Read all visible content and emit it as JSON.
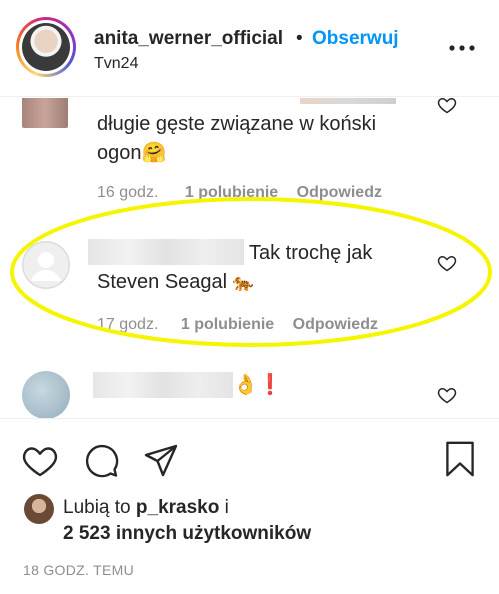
{
  "header": {
    "username": "anita_werner_official",
    "separator": "•",
    "follow_label": "Obserwuj",
    "location": "Tvn24"
  },
  "comments": [
    {
      "text_line1": "długie gęste związane w koński",
      "text_line2": "ogon",
      "emoji": "🤗",
      "time": "16 godz.",
      "likes": "1 polubienie",
      "reply": "Odpowiedz"
    },
    {
      "text_line1": "Tak trochę jak",
      "text_line2": "Steven Seagal",
      "emoji": "🐅",
      "time": "17 godz.",
      "likes": "1 polubienie",
      "reply": "Odpowiedz"
    },
    {
      "emoji": "👌❗"
    }
  ],
  "likes": {
    "prefix": "Lubią to",
    "user": "p_krasko",
    "conjunction": "i",
    "others": "2 523 innych użytkowników"
  },
  "timestamp": "18 GODZ. TEMU",
  "colors": {
    "accent": "#0095f6",
    "highlight": "#f5f500",
    "text": "#262626",
    "muted": "#8e8e8e"
  },
  "icons": [
    "more-options-icon",
    "heart-icon",
    "comment-icon",
    "share-icon",
    "bookmark-icon"
  ]
}
